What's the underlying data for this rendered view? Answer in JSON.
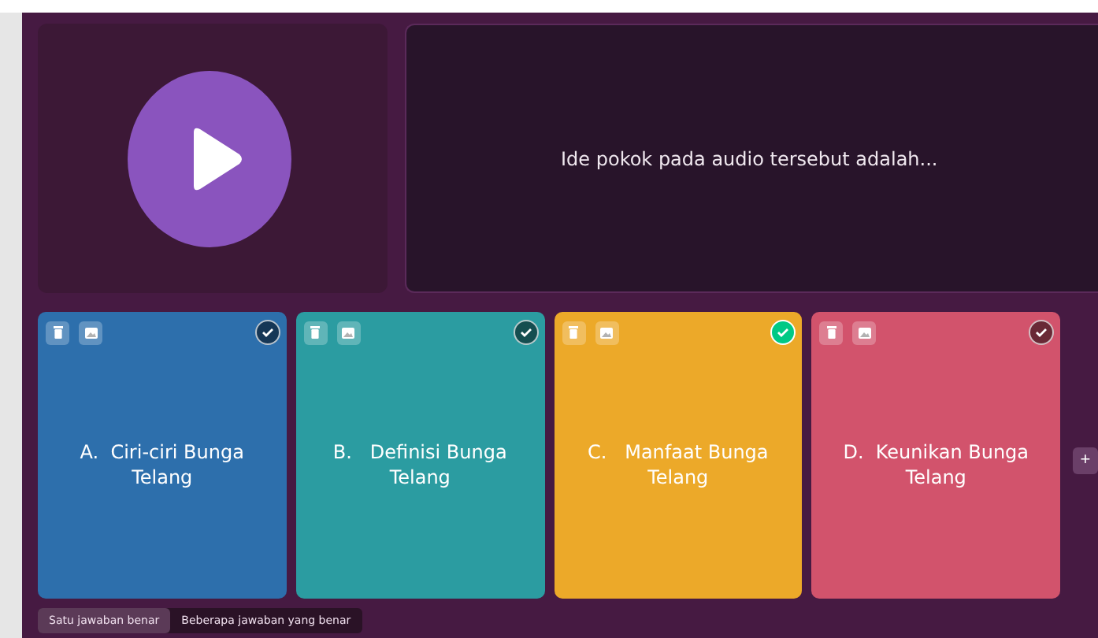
{
  "question": {
    "text": "Ide pokok pada audio tersebut adalah..."
  },
  "options": [
    {
      "label": "A.  Ciri-ciri Bunga Telang",
      "color": "#2d6fac",
      "correct": false
    },
    {
      "label": "B.   Definisi Bunga Telang",
      "color": "#2b9ca1",
      "correct": false
    },
    {
      "label": "C.   Manfaat Bunga Telang",
      "color": "#eca929",
      "correct": true
    },
    {
      "label": "D.  Keunikan Bunga Telang",
      "color": "#d2536c",
      "correct": false
    }
  ],
  "add_button": "+",
  "answer_modes": [
    {
      "label": "Satu jawaban benar",
      "selected": true
    },
    {
      "label": "Beberapa jawaban yang benar",
      "selected": false
    }
  ]
}
